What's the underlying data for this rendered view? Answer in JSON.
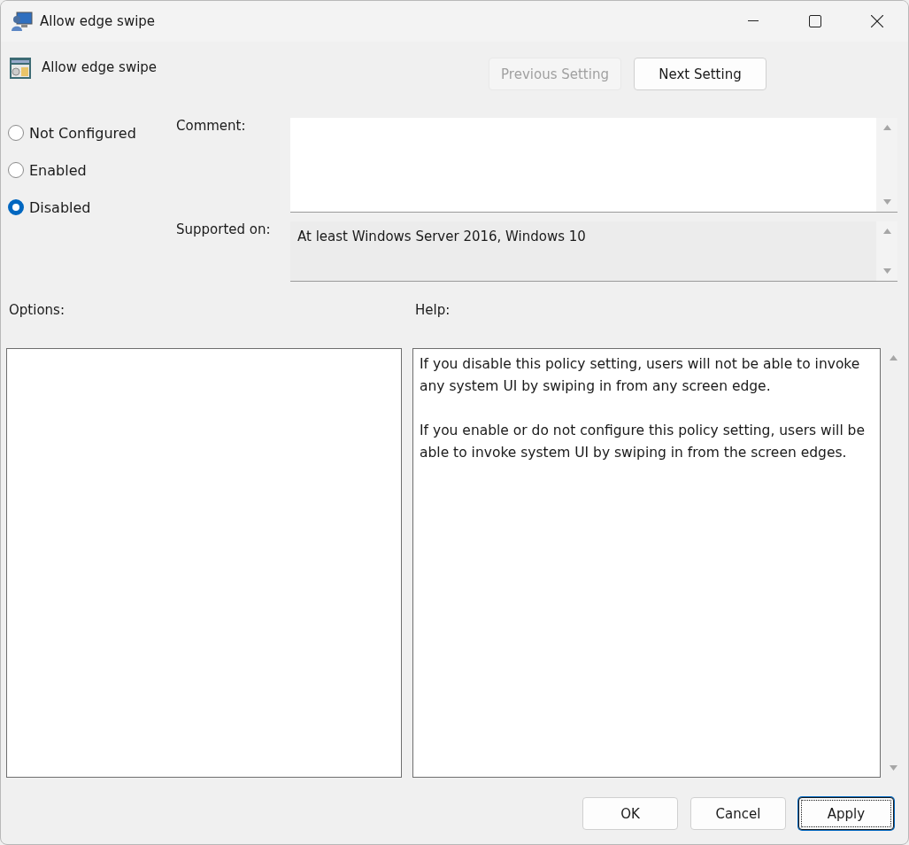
{
  "window": {
    "title": "Allow edge swipe"
  },
  "header": {
    "title": "Allow edge swipe"
  },
  "nav_buttons": [
    {
      "label": "Previous Setting",
      "disabled": true
    },
    {
      "label": "Next Setting",
      "disabled": false
    }
  ],
  "state_options": [
    {
      "label": "Not Configured",
      "selected": false
    },
    {
      "label": "Enabled",
      "selected": false
    },
    {
      "label": "Disabled",
      "selected": true
    }
  ],
  "comment": {
    "label": "Comment:"
  },
  "supported_on": {
    "label": "Supported on:",
    "value": "At least Windows Server 2016, Windows 10"
  },
  "options": {
    "label": "Options:"
  },
  "help": {
    "label": "Help:",
    "paragraphs": [
      "If you disable this policy setting, users will not be able to invoke any system UI by swiping in from any screen edge.",
      "If you enable or do not configure this policy setting, users will be able to invoke system UI by swiping in from the screen edges."
    ]
  },
  "buttons": [
    {
      "label": "OK",
      "focused": false
    },
    {
      "label": "Cancel",
      "focused": false
    },
    {
      "label": "Apply",
      "focused": true
    }
  ]
}
